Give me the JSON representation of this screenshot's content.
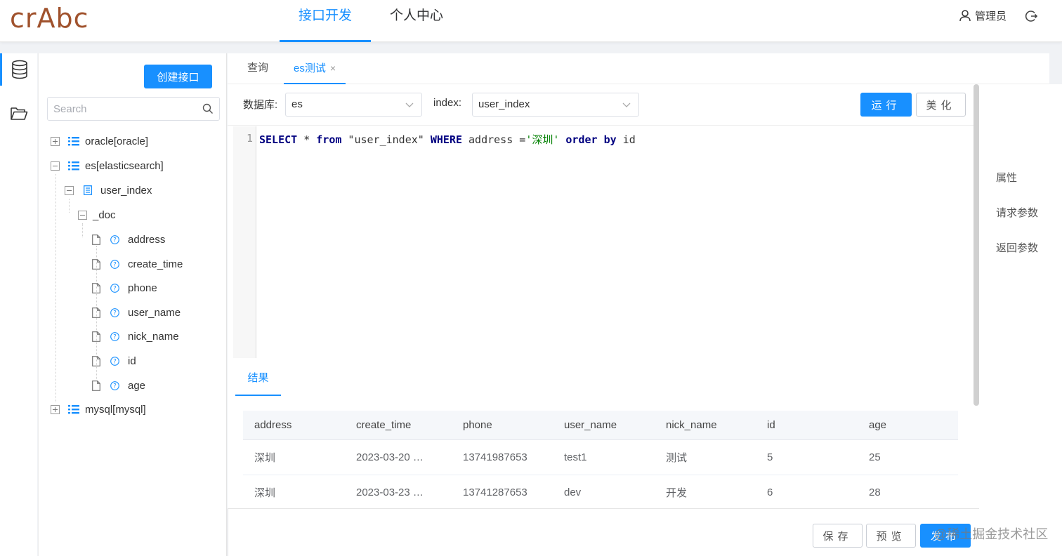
{
  "app": {
    "logo": "crAbc"
  },
  "header": {
    "nav": [
      "接口开发",
      "个人中心"
    ],
    "user_label": "管理员"
  },
  "sidebar": {
    "create_button": "创建接口",
    "search_placeholder": "Search",
    "tree": [
      {
        "label": "oracle[oracle]",
        "state": "collapsed"
      },
      {
        "label": "es[elasticsearch]",
        "state": "expanded"
      },
      {
        "label": "user_index",
        "state": "expanded"
      },
      {
        "label": "_doc",
        "state": "expanded"
      },
      {
        "label": "address"
      },
      {
        "label": "create_time"
      },
      {
        "label": "phone"
      },
      {
        "label": "user_name"
      },
      {
        "label": "nick_name"
      },
      {
        "label": "id"
      },
      {
        "label": "age"
      },
      {
        "label": "mysql[mysql]",
        "state": "collapsed"
      }
    ]
  },
  "main": {
    "tabs": [
      {
        "label": "查询"
      },
      {
        "label": "es测试",
        "close": "×"
      }
    ],
    "toolbar": {
      "db_label": "数据库:",
      "db_value": "es",
      "index_label": "index:",
      "index_value": "user_index",
      "run_button": "运行",
      "beautify_button": "美化"
    },
    "editor": {
      "line_number": "1",
      "code": {
        "k1": "SELECT",
        "t1": " * ",
        "k2": "from",
        "t2": " \"user_index\" ",
        "k3": "WHERE",
        "t3": " address =",
        "s1": "'深圳'",
        "t4": " ",
        "k4": "order by",
        "t5": " id"
      }
    },
    "result_tab": "结果",
    "table": {
      "columns": [
        "address",
        "create_time",
        "phone",
        "user_name",
        "nick_name",
        "id",
        "age"
      ],
      "rows": [
        [
          "深圳",
          "2023-03-20 …",
          "13741987653",
          "test1",
          "测试",
          "5",
          "25"
        ],
        [
          "深圳",
          "2023-03-23 …",
          "13741287653",
          "dev",
          "开发",
          "6",
          "28"
        ]
      ]
    },
    "footer": {
      "save_button": "保存",
      "preview_button": "预览",
      "publish_button": "发布"
    }
  },
  "right_panel": {
    "items": [
      "属性",
      "请求参数",
      "返回参数"
    ]
  },
  "watermark": "@稀土掘金技术社区",
  "colors": {
    "accent": "#1890ff",
    "logo": "#a0522d",
    "keyword": "#000080",
    "string": "#008000"
  },
  "icons": [
    "database-icon",
    "folder-open-icon",
    "search-icon",
    "list-icon",
    "index-table-icon",
    "file-icon",
    "field-type-icon",
    "user-icon",
    "logout-icon",
    "chevron-down-icon",
    "close-icon"
  ]
}
